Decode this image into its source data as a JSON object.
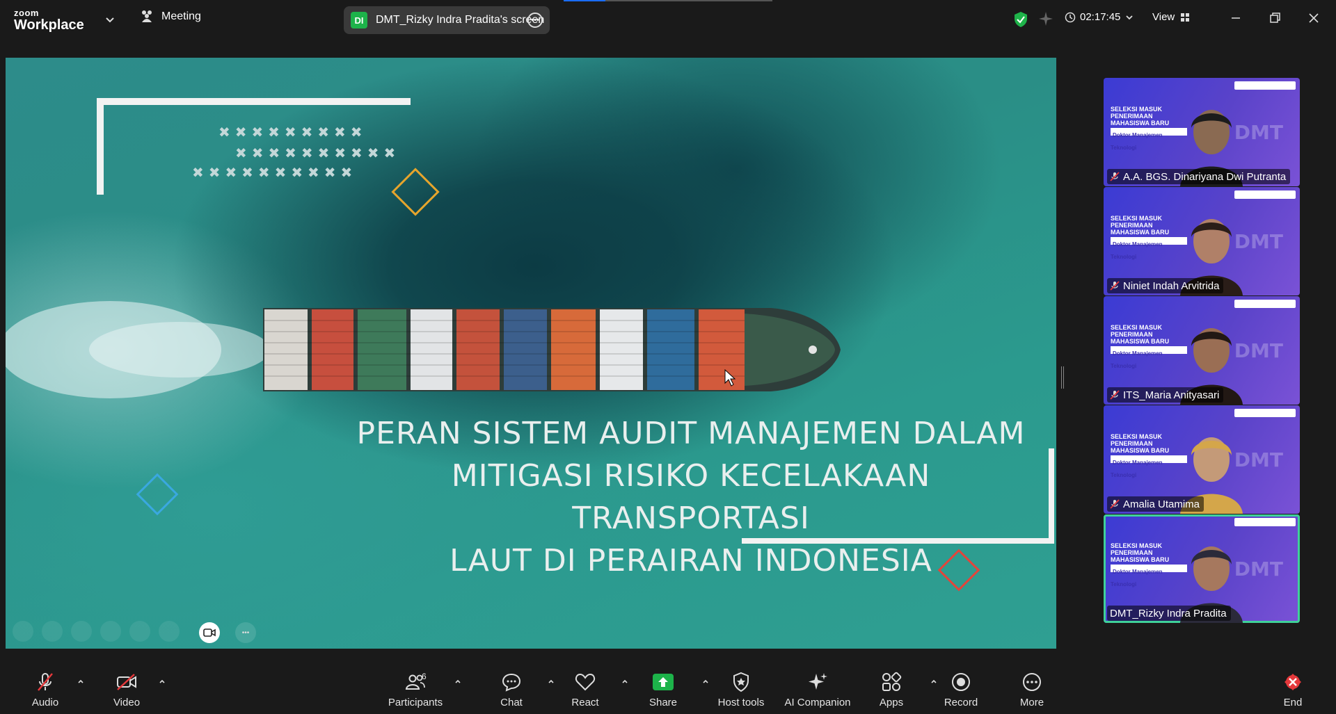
{
  "app": {
    "brand_top": "zoom",
    "brand_bottom": "Workplace",
    "meeting_label": "Meeting",
    "screen_pill": {
      "initials": "DI",
      "label": "DMT_Rizky Indra Pradita's screen"
    },
    "timer": "02:17:45",
    "view_label": "View"
  },
  "slide": {
    "title_lines": [
      "PERAN SISTEM AUDIT MANAJEMEN DALAM",
      "MITIGASI RISIKO KECELAKAAN TRANSPORTASI",
      "LAUT DI PERAIRAN INDONESIA"
    ]
  },
  "participants": [
    {
      "name": "A.A. BGS. Dinariyana Dwi Putranta",
      "muted": true
    },
    {
      "name": "Niniet Indah Arvitrida",
      "muted": true
    },
    {
      "name": "ITS_Maria Anityasari",
      "muted": true
    },
    {
      "name": "Amalia Utamima",
      "muted": true
    },
    {
      "name": "DMT_Rizky Indra Pradita",
      "muted": false
    }
  ],
  "tile_text": {
    "seleksi": "SELEKSI MASUK",
    "penerimaan": "PENERIMAAN",
    "mahasiswa": "MAHASISWA BARU",
    "program": "Doktor Manajemen Teknologi",
    "dmt": "DMT"
  },
  "toolbar": {
    "audio": "Audio",
    "video": "Video",
    "participants": "Participants",
    "participants_count": "6",
    "chat": "Chat",
    "react": "React",
    "share": "Share",
    "host_tools": "Host tools",
    "ai_companion": "AI Companion",
    "apps": "Apps",
    "record": "Record",
    "more": "More",
    "end": "End"
  },
  "colors": {
    "share_green": "#1db34a",
    "end_red": "#e5383b",
    "active_tile": "#3fd19a",
    "tile_purple": "#5a43c9"
  }
}
